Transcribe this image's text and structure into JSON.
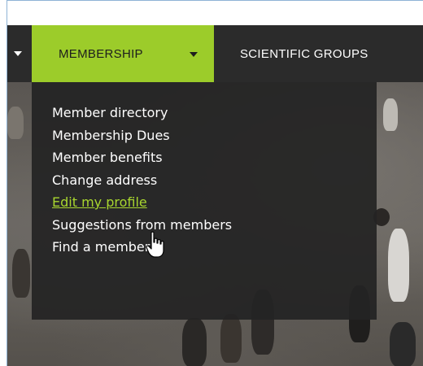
{
  "nav": {
    "membership_label": "MEMBERSHIP",
    "scientific_label": "SCIENTIFIC GROUPS",
    "active_color": "#9ccc2a"
  },
  "dropdown": {
    "items": [
      {
        "label": "Member directory"
      },
      {
        "label": "Membership Dues"
      },
      {
        "label": "Member benefits"
      },
      {
        "label": "Change address"
      },
      {
        "label": "Edit my profile",
        "state": "hover"
      },
      {
        "label": "Suggestions from members"
      },
      {
        "label": "Find a member"
      }
    ],
    "hover_color": "#a8d62f"
  },
  "cursor": {
    "icon": "hand-pointer-icon"
  }
}
